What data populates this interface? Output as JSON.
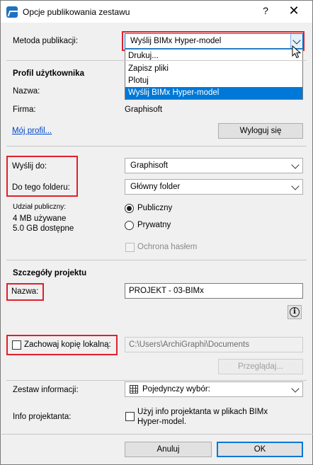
{
  "window": {
    "title": "Opcje publikowania zestawu",
    "help_label": "?",
    "close_label": "✕"
  },
  "method": {
    "label": "Metoda publikacji:",
    "selected": "Wyślij BIMx Hyper-model",
    "options": [
      "Drukuj...",
      "Zapisz pliki",
      "Plotuj",
      "Wyślij BIMx Hyper-model"
    ]
  },
  "profile": {
    "heading": "Profil użytkownika",
    "name_label": "Nazwa:",
    "name_value": "",
    "company_label": "Firma:",
    "company_value": "Graphisoft",
    "my_profile_link": "Mój profil...",
    "logout_button": "Wyloguj się"
  },
  "upload": {
    "send_to_label": "Wyślij do:",
    "send_to_value": "Graphisoft",
    "folder_label": "Do tego folderu:",
    "folder_value": "Główny folder",
    "share_label": "Udział publiczny:",
    "used": "4 MB używane",
    "available": "5.0 GB dostępne",
    "public_label": "Publiczny",
    "private_label": "Prywatny",
    "password_label": "Ochrona hasłem"
  },
  "project": {
    "heading": "Szczegóły projektu",
    "name_label": "Nazwa:",
    "name_value": "PROJEKT - 03-BIMx",
    "keep_local_label": "Zachowaj kopię lokalną:",
    "local_path": "C:\\Users\\ArchiGraphi\\Documents",
    "browse_button": "Przeglądaj...",
    "info_set_label": "Zestaw informacji:",
    "info_set_value": "Pojedynczy wybór:",
    "designer_label": "Info projektanta:",
    "designer_check_line1": "Użyj info projektanta w plikach BIMx",
    "designer_check_line2": "Hyper-model."
  },
  "footer": {
    "cancel": "Anuluj",
    "ok": "OK"
  },
  "colors": {
    "highlight_red": "#e0202a",
    "selection_blue": "#0078d7"
  }
}
